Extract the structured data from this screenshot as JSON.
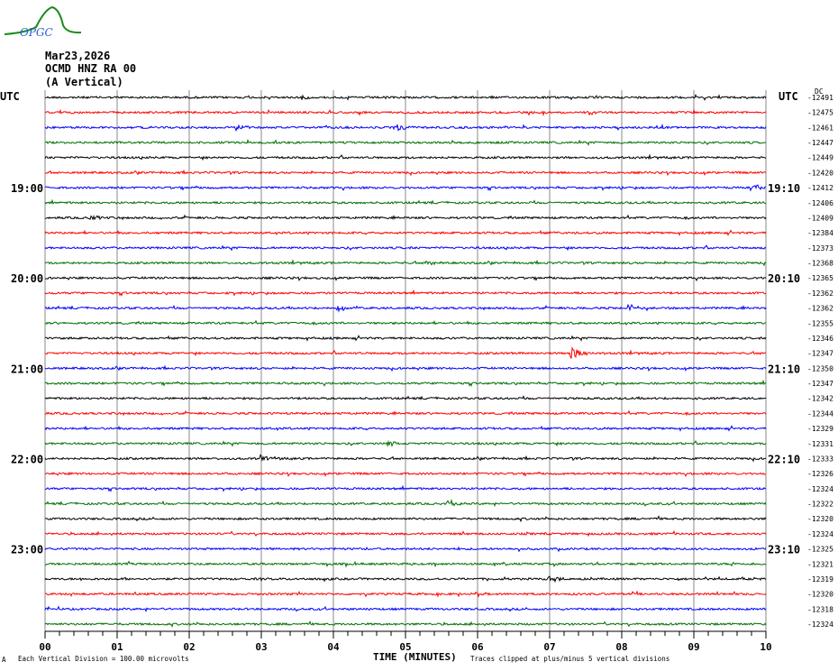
{
  "header": {
    "logo_text": "OPGC",
    "date": "Mar23,2026",
    "station": "OCMD HNZ RA 00",
    "component": "(A Vertical)"
  },
  "chart_data": {
    "type": "line",
    "title": "Mar23,2026 OCMD HNZ RA 00 (A Vertical)",
    "xlabel": "TIME (MINUTES)",
    "xlim": [
      0,
      10
    ],
    "x_ticks": [
      "00",
      "01",
      "02",
      "03",
      "04",
      "05",
      "06",
      "07",
      "08",
      "09",
      "10"
    ],
    "left_axis_title": "UTC",
    "right_axis_title": "UTC",
    "dc_label": "DC",
    "left_time_labels": [
      {
        "row": 6,
        "label": "19:00"
      },
      {
        "row": 12,
        "label": "20:00"
      },
      {
        "row": 18,
        "label": "21:00"
      },
      {
        "row": 24,
        "label": "22:00"
      },
      {
        "row": 30,
        "label": "23:00"
      }
    ],
    "right_time_labels": [
      {
        "row": 6,
        "label": "19:10"
      },
      {
        "row": 12,
        "label": "20:10"
      },
      {
        "row": 18,
        "label": "21:10"
      },
      {
        "row": 24,
        "label": "22:10"
      },
      {
        "row": 30,
        "label": "23:10"
      }
    ],
    "trace_colors": [
      "#000000",
      "#ff0000",
      "#0000ff",
      "#007000"
    ],
    "dc_offsets": [
      -12491,
      -12475,
      -12461,
      -12447,
      -12449,
      -12420,
      -12412,
      -12406,
      -12409,
      -12384,
      -12373,
      -12368,
      -12365,
      -12362,
      -12362,
      -12355,
      -12346,
      -12347,
      -12350,
      -12347,
      -12342,
      -12344,
      -12329,
      -12331,
      -12333,
      -12326,
      -12324,
      -12322,
      -12320,
      -12324,
      -12325,
      -12321,
      -12319,
      -12320,
      -12318,
      -12324
    ],
    "events": [
      {
        "row": 0,
        "minute": 3.55,
        "amp": 4
      },
      {
        "row": 2,
        "minute": 2.65,
        "amp": 4
      },
      {
        "row": 2,
        "minute": 4.85,
        "amp": 5
      },
      {
        "row": 6,
        "minute": 9.8,
        "amp": 5
      },
      {
        "row": 8,
        "minute": 0.6,
        "amp": 4
      },
      {
        "row": 11,
        "minute": 5.3,
        "amp": 4
      },
      {
        "row": 14,
        "minute": 4.05,
        "amp": 5
      },
      {
        "row": 14,
        "minute": 8.1,
        "amp": 5
      },
      {
        "row": 17,
        "minute": 7.3,
        "amp": 10
      },
      {
        "row": 23,
        "minute": 4.75,
        "amp": 3
      },
      {
        "row": 24,
        "minute": 3.0,
        "amp": 4
      },
      {
        "row": 27,
        "minute": 5.6,
        "amp": 4
      },
      {
        "row": 32,
        "minute": 7.0,
        "amp": 4
      }
    ],
    "scale_note": "Each Vertical Division =  100.00 microvolts",
    "clip_note": "Traces clipped at plus/minus 5 vertical divisions",
    "corner_mark": "A"
  }
}
